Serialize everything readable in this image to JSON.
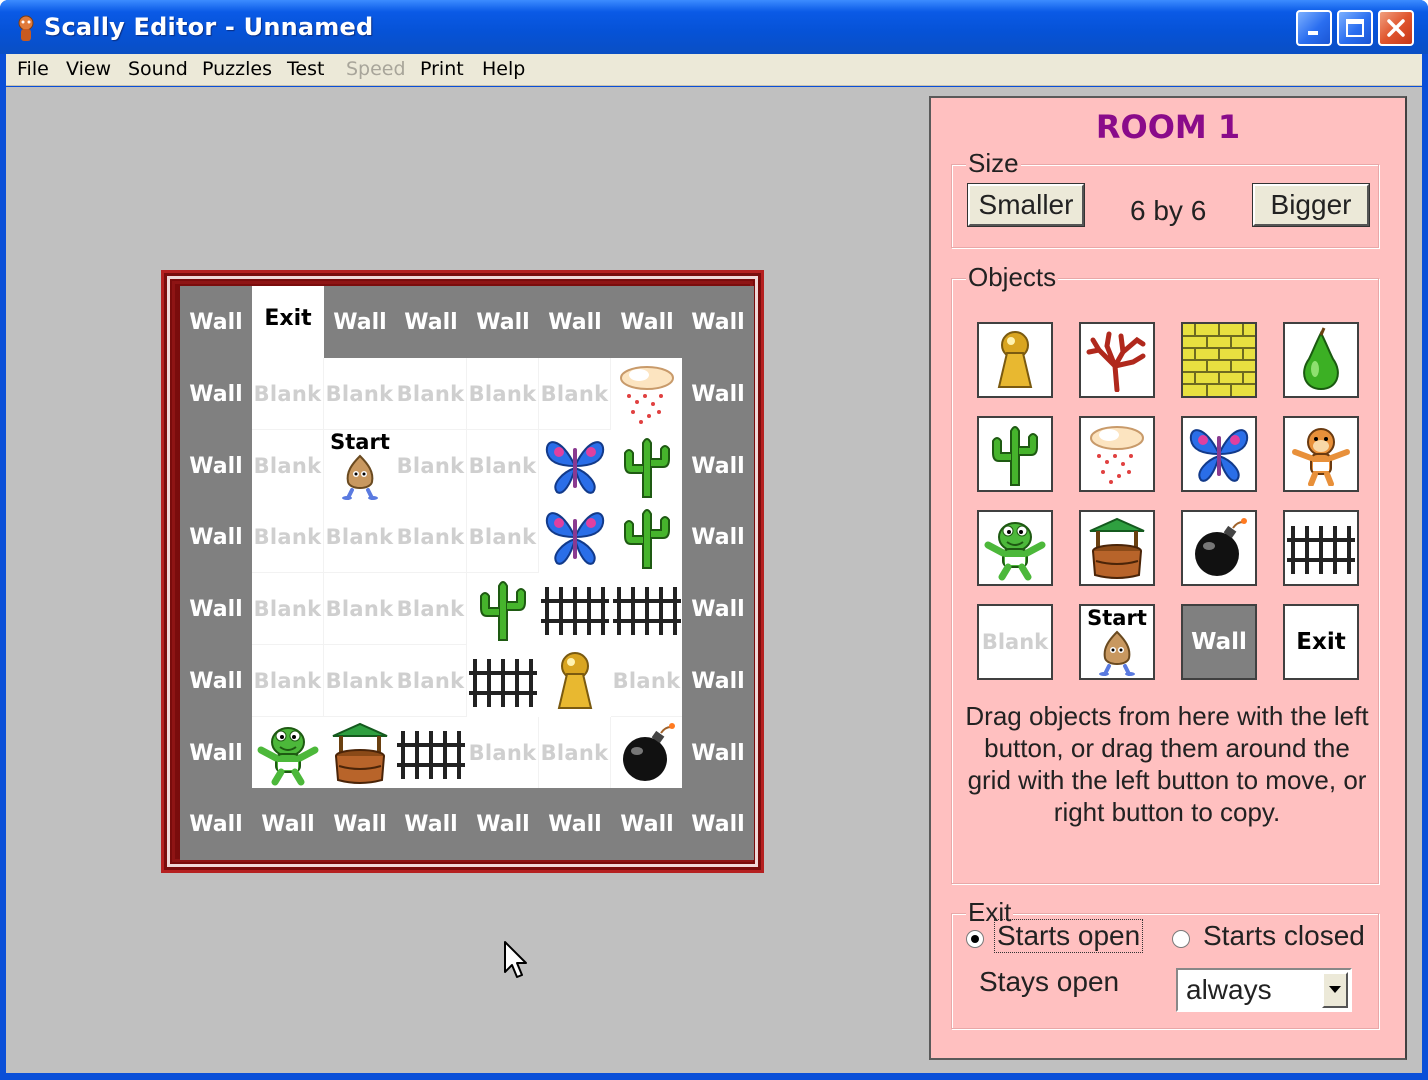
{
  "window": {
    "title": "Scally Editor - Unnamed"
  },
  "menu": {
    "items": [
      {
        "label": "File",
        "enabled": true
      },
      {
        "label": "View",
        "enabled": true
      },
      {
        "label": "Sound",
        "enabled": true
      },
      {
        "label": "Puzzles",
        "enabled": true
      },
      {
        "label": "Test",
        "enabled": true
      },
      {
        "label": "Speed",
        "enabled": false
      },
      {
        "label": "Print",
        "enabled": true
      },
      {
        "label": "Help",
        "enabled": true
      }
    ]
  },
  "grid": {
    "rows": [
      [
        "Wall",
        "Exit",
        "Wall",
        "Wall",
        "Wall",
        "Wall",
        "Wall",
        "Wall"
      ],
      [
        "Wall",
        "Blank",
        "Blank",
        "Blank",
        "Blank",
        "Blank",
        "rain-cloud",
        "Wall"
      ],
      [
        "Wall",
        "Blank",
        "Start",
        "Blank",
        "Blank",
        "butterfly",
        "cactus",
        "Wall"
      ],
      [
        "Wall",
        "Blank",
        "Blank",
        "Blank",
        "Blank",
        "butterfly",
        "cactus",
        "Wall"
      ],
      [
        "Wall",
        "Blank",
        "Blank",
        "Blank",
        "cactus",
        "fence",
        "fence",
        "Wall"
      ],
      [
        "Wall",
        "Blank",
        "Blank",
        "Blank",
        "fence",
        "keyhole",
        "Blank",
        "Wall"
      ],
      [
        "Wall",
        "frog",
        "well",
        "fence",
        "Blank",
        "Blank",
        "bomb",
        "Wall"
      ],
      [
        "Wall",
        "Wall",
        "Wall",
        "Wall",
        "Wall",
        "Wall",
        "Wall",
        "Wall"
      ]
    ],
    "labels": {
      "wall": "Wall",
      "blank": "Blank",
      "exit": "Exit",
      "start": "Start"
    }
  },
  "panel": {
    "room_title": "ROOM 1",
    "size": {
      "legend": "Size",
      "smaller_label": "Smaller",
      "bigger_label": "Bigger",
      "value_text": "6 by 6"
    },
    "objects": {
      "legend": "Objects",
      "tiles": [
        [
          "keyhole",
          "tree",
          "brick-wall",
          "pear"
        ],
        [
          "cactus",
          "rain-cloud",
          "butterfly",
          "monkey"
        ],
        [
          "frog",
          "well",
          "bomb",
          "fence"
        ],
        [
          "Blank",
          "Start",
          "Wall",
          "Exit"
        ]
      ],
      "help_text": "Drag objects from here with the left button, or drag them around the grid with the left button to move, or right button to copy."
    },
    "exit": {
      "legend": "Exit",
      "starts_open_label": "Starts open",
      "starts_closed_label": "Starts closed",
      "selected": "Starts open",
      "stays_open_label": "Stays open",
      "stays_open_value": "always"
    }
  },
  "colors": {
    "panel_bg": "#ffc0c0",
    "room_title": "#8a0b8a",
    "wall_tile": "#808080",
    "grid_frame": "#7a0c0c",
    "titlebar": "#0652d6"
  }
}
